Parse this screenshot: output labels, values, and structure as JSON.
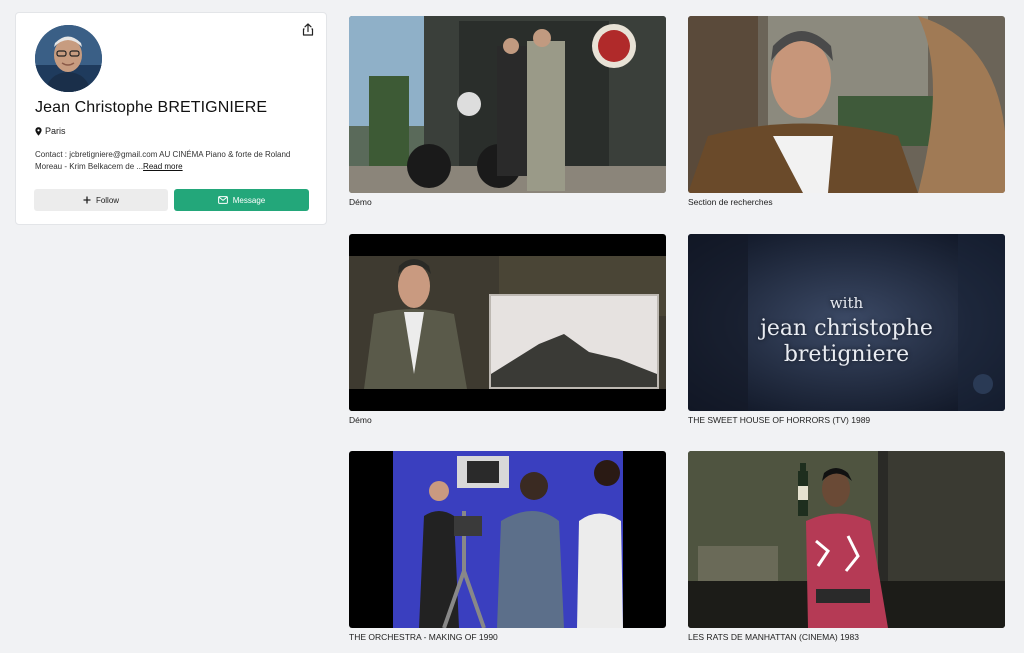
{
  "profile": {
    "name": "Jean Christophe BRETIGNIERE",
    "location": "Paris",
    "bio": "Contact : jcbretigniere@gmail.com AU CINÉMA Piano & forte de Roland Moreau - Krim Belkacem de ...",
    "read_more": "Read more",
    "follow_label": "Follow",
    "message_label": "Message",
    "accent_color": "#23a77a"
  },
  "videos": [
    {
      "title": "Démo",
      "thumbnail": "motorcycle-scene"
    },
    {
      "title": "Section de recherches",
      "thumbnail": "man-in-jacket"
    },
    {
      "title": "Démo",
      "thumbnail": "man-with-painting"
    },
    {
      "title": "THE SWEET HOUSE OF HORRORS (TV) 1989",
      "thumbnail": "title-card",
      "overlay": [
        "with",
        "jean christophe",
        "bretigniere"
      ]
    },
    {
      "title": "THE ORCHESTRA - MAKING OF 1990",
      "thumbnail": "film-set"
    },
    {
      "title": "LES RATS DE MANHATTAN (CINEMA) 1983",
      "thumbnail": "man-with-bottle"
    }
  ]
}
